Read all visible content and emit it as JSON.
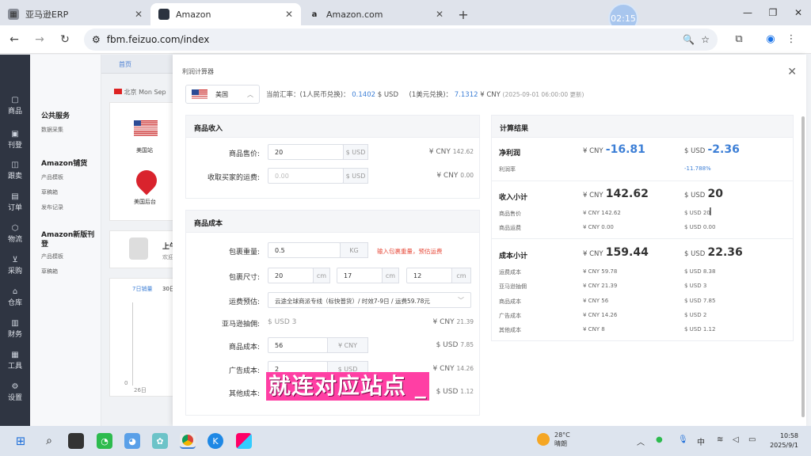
{
  "browser": {
    "tabs": [
      {
        "title": "亚马逊ERP",
        "active": false
      },
      {
        "title": "Amazon",
        "active": true
      },
      {
        "title": "Amazon.com",
        "active": false
      }
    ],
    "timer": "02:15",
    "url": "fbm.feizuo.com/index"
  },
  "leftnav": {
    "items": [
      "商品",
      "刊登",
      "跟卖",
      "订单",
      "物流",
      "采购",
      "仓库",
      "财务",
      "工具",
      "设置"
    ]
  },
  "submenu": {
    "groups": [
      {
        "title": "公共服务",
        "items": [
          "数据采集"
        ]
      },
      {
        "title": "Amazon铺货",
        "items": [
          "产品模板",
          "草稿箱",
          "发布记录"
        ]
      },
      {
        "title": "Amazon新版刊登",
        "items": [
          "产品模板",
          "草稿箱"
        ]
      }
    ]
  },
  "background": {
    "home_tab": "首页",
    "region_text": "北京 Mon Sep",
    "us_site": "美国站",
    "us_backend": "美国后台",
    "partial_title": "上午",
    "partial_sub": "欢迎",
    "sales_label": "7日销量",
    "sales_tab2": "30日",
    "axis_date": "26日",
    "axis_zero": "0"
  },
  "modal": {
    "title": "利润计算器",
    "country": "美国",
    "rate_prefix": "当前汇率：",
    "rate_cny_label": "(1人民币兑换)：",
    "rate_cny_value": "0.1402",
    "rate_cny_unit": "$ USD",
    "rate_usd_label": "(1美元兑换)：",
    "rate_usd_value": "7.1312",
    "rate_usd_unit": "¥ CNY",
    "rate_time": "(2025-09-01 06:00:00 更新)"
  },
  "income": {
    "header": "商品收入",
    "price_label": "商品售价:",
    "price_value": "20",
    "price_unit": "$ USD",
    "price_cny_sym": "¥ CNY",
    "price_cny_val": "142.62",
    "shipping_label": "收取买家的运费:",
    "shipping_placeholder": "0.00",
    "shipping_unit": "$ USD",
    "shipping_cny_sym": "¥ CNY",
    "shipping_cny_val": "0.00"
  },
  "cost": {
    "header": "商品成本",
    "weight_label": "包裹重量:",
    "weight_value": "0.5",
    "weight_unit": "KG",
    "weight_hint": "输入包裹重量，预估运费",
    "size_label": "包裹尺寸:",
    "size_l": "20",
    "size_w": "17",
    "size_h": "12",
    "size_unit": "cm",
    "ship_est_label": "运费预估:",
    "ship_est_value": "云途全球商派专线（标快普货）/ 时效7-9日 / 运费59.78元",
    "commission_label": "亚马逊抽佣:",
    "commission_usd": "$ USD 3",
    "commission_cny_sym": "¥ CNY",
    "commission_cny_val": "21.39",
    "product_cost_label": "商品成本:",
    "product_cost_value": "56",
    "product_cost_unit": "¥ CNY",
    "product_cost_usd_sym": "$ USD",
    "product_cost_usd_val": "7.85",
    "ad_cost_label": "广告成本:",
    "ad_cost_value": "2",
    "ad_cost_unit": "$ USD",
    "ad_cost_cny_sym": "¥ CNY",
    "ad_cost_cny_val": "14.26",
    "other_cost_label": "其他成本:",
    "other_cost_usd_sym": "$ USD",
    "other_cost_usd_val": "1.12"
  },
  "results": {
    "header": "计算结果",
    "profit_label": "净利润",
    "profit_cny_unit": "¥ CNY",
    "profit_cny": "-16.81",
    "profit_usd_unit": "$ USD",
    "profit_usd": "-2.36",
    "margin_label": "利润率",
    "margin_value": "-11.788%",
    "income_label": "收入小计",
    "income_cny_unit": "¥ CNY",
    "income_cny": "142.62",
    "income_usd_unit": "$ USD",
    "income_usd": "20",
    "income_rows": [
      {
        "label": "商品售价",
        "cny": "¥ CNY 142.62",
        "usd": "$ USD 20"
      },
      {
        "label": "商品运费",
        "cny": "¥ CNY 0.00",
        "usd": "$ USD 0.00"
      }
    ],
    "cost_label": "成本小计",
    "cost_cny_unit": "¥ CNY",
    "cost_cny": "159.44",
    "cost_usd_unit": "$ USD",
    "cost_usd": "22.36",
    "cost_rows": [
      {
        "label": "运费成本",
        "cny": "¥ CNY 59.78",
        "usd": "$ USD 8.38"
      },
      {
        "label": "亚马逊抽佣",
        "cny": "¥ CNY 21.39",
        "usd": "$ USD 3"
      },
      {
        "label": "商品成本",
        "cny": "¥ CNY 56",
        "usd": "$ USD 7.85"
      },
      {
        "label": "广告成本",
        "cny": "¥ CNY 14.26",
        "usd": "$ USD 2"
      },
      {
        "label": "其他成本",
        "cny": "¥ CNY 8",
        "usd": "$ USD 1.12"
      }
    ]
  },
  "caption": "就连对应站点 _",
  "taskbar": {
    "temperature": "28°C",
    "weather": "晴朗",
    "ime": "中",
    "time": "10:58",
    "date": "2025/9/1"
  },
  "colors": {
    "accent": "#3d7fd6",
    "caption_bg": "#ff3fa4",
    "hint": "#e74c3c",
    "nav_bg": "#2f3542"
  }
}
